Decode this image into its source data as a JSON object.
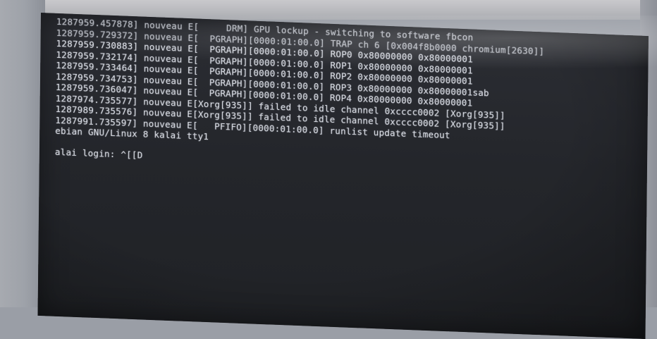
{
  "console": {
    "log_lines": [
      "1287959.457878] nouveau E[     DRM] GPU lockup - switching to software fbcon",
      "1287959.729372] nouveau E[  PGRAPH][0000:01:00.0] TRAP ch 6 [0x004f8b0000 chromium[2630]]",
      "1287959.730883] nouveau E[  PGRAPH][0000:01:00.0] ROP0 0x80000000 0x80000001",
      "1287959.732174] nouveau E[  PGRAPH][0000:01:00.0] ROP1 0x80000000 0x80000001",
      "1287959.733464] nouveau E[  PGRAPH][0000:01:00.0] ROP2 0x80000000 0x80000001",
      "1287959.734753] nouveau E[  PGRAPH][0000:01:00.0] ROP3 0x80000000 0x80000001sab",
      "1287959.736047] nouveau E[  PGRAPH][0000:01:00.0] ROP4 0x80000000 0x80000001",
      "1287974.735577] nouveau E[Xorg[935]] failed to idle channel 0xcccc0002 [Xorg[935]]",
      "1287989.735576] nouveau E[Xorg[935]] failed to idle channel 0xcccc0002 [Xorg[935]]",
      "1287991.735597] nouveau E[   PFIFO][0000:01:00.0] runlist update timeout"
    ],
    "banner": "ebian GNU/Linux 8 kalai tty1",
    "login_prompt": "alai login: ^[[D"
  }
}
